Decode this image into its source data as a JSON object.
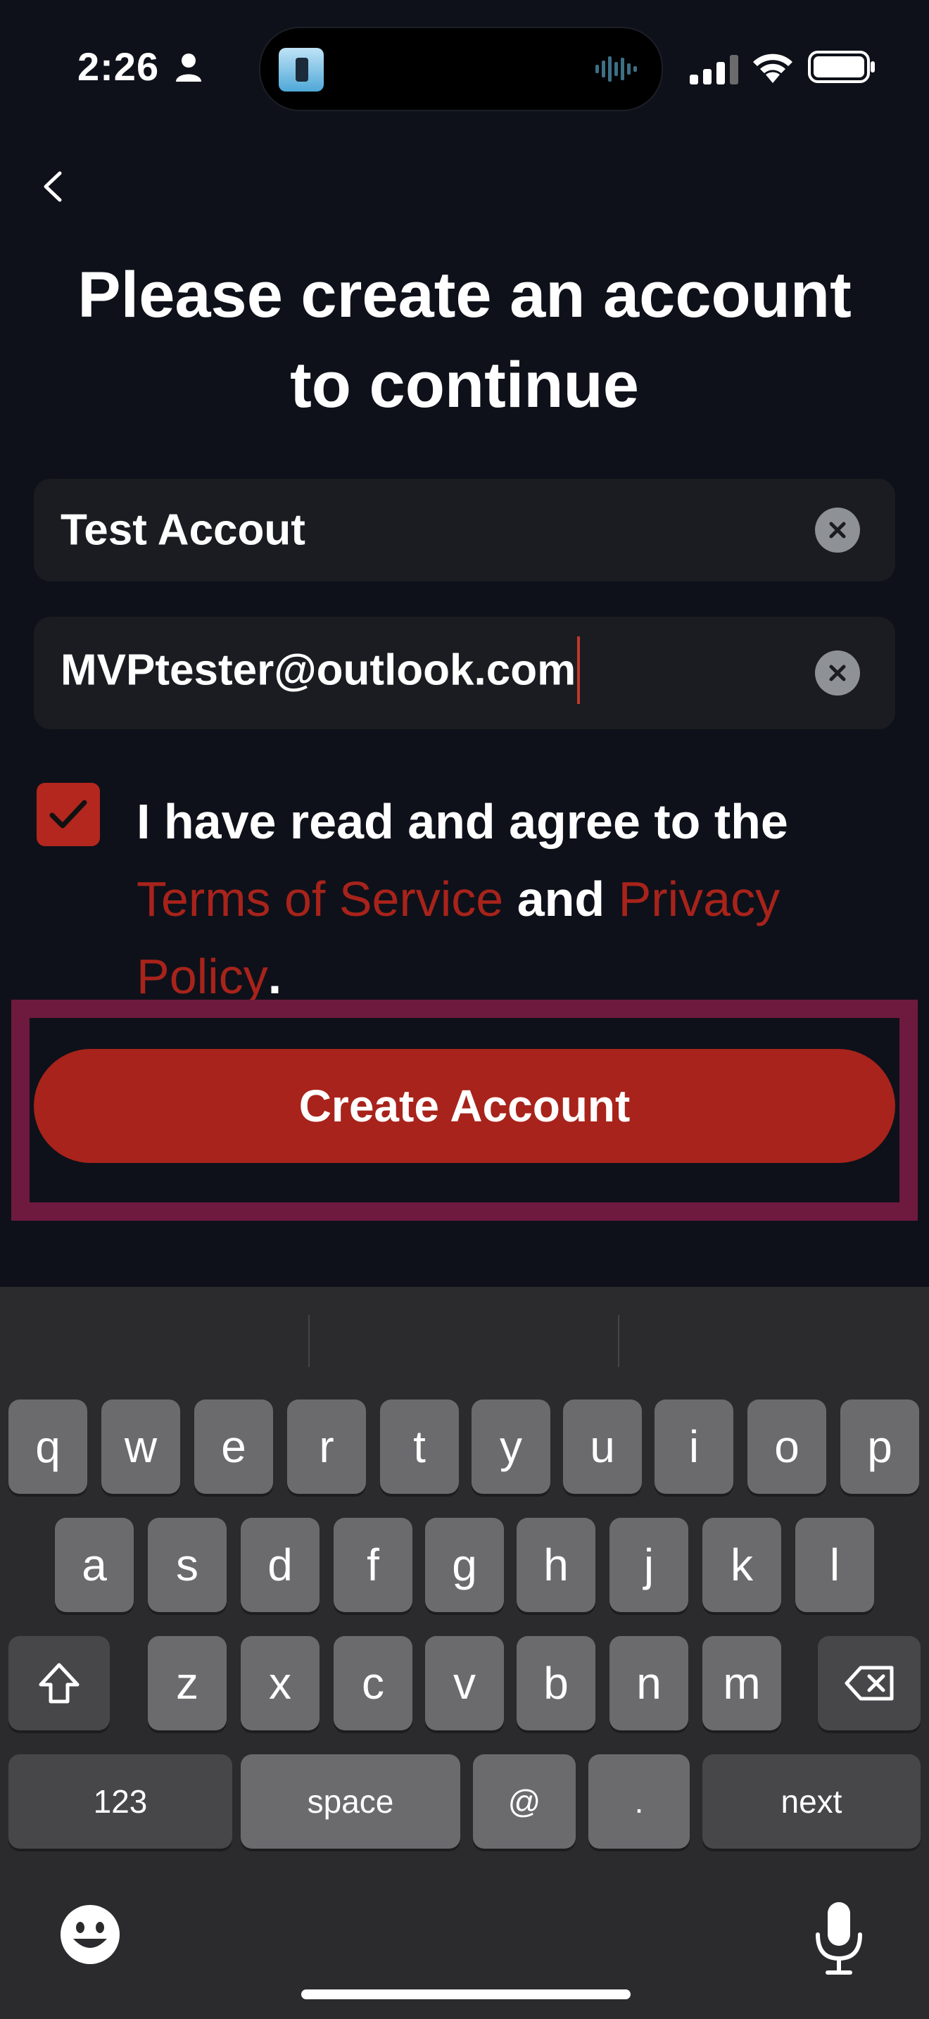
{
  "status_bar": {
    "time": "2:26",
    "icons": [
      "person-icon",
      "cellular-signal-icon",
      "wifi-icon",
      "battery-icon"
    ]
  },
  "header": {
    "back_icon": "chevron-left-icon",
    "title_line1": "Please create an account",
    "title_line2": "to continue"
  },
  "form": {
    "name_value": "Test Accout",
    "email_value": "MVPtester@outlook.com",
    "clear_icon": "clear-x-icon",
    "checkbox_checked": true,
    "agree_prefix": "I have read and agree to the",
    "terms_link": "Terms of Service",
    "agree_and": "and",
    "privacy_link": "Privacy Policy",
    "agree_suffix": ".",
    "submit_label": "Create Account"
  },
  "keyboard": {
    "row1": [
      "q",
      "w",
      "e",
      "r",
      "t",
      "y",
      "u",
      "i",
      "o",
      "p"
    ],
    "row2": [
      "a",
      "s",
      "d",
      "f",
      "g",
      "h",
      "j",
      "k",
      "l"
    ],
    "row3": [
      "z",
      "x",
      "c",
      "v",
      "b",
      "n",
      "m"
    ],
    "numbers_label": "123",
    "space_label": "space",
    "at_label": "@",
    "dot_label": ".",
    "next_label": "next",
    "icons": [
      "shift-icon",
      "backspace-icon",
      "emoji-icon",
      "microphone-icon"
    ]
  },
  "colors": {
    "background": "#0e1119",
    "accent": "#a8231b",
    "field_bg": "#1b1c21",
    "highlight": "#6e1a3e",
    "keyboard_bg": "#2b2b2e"
  }
}
